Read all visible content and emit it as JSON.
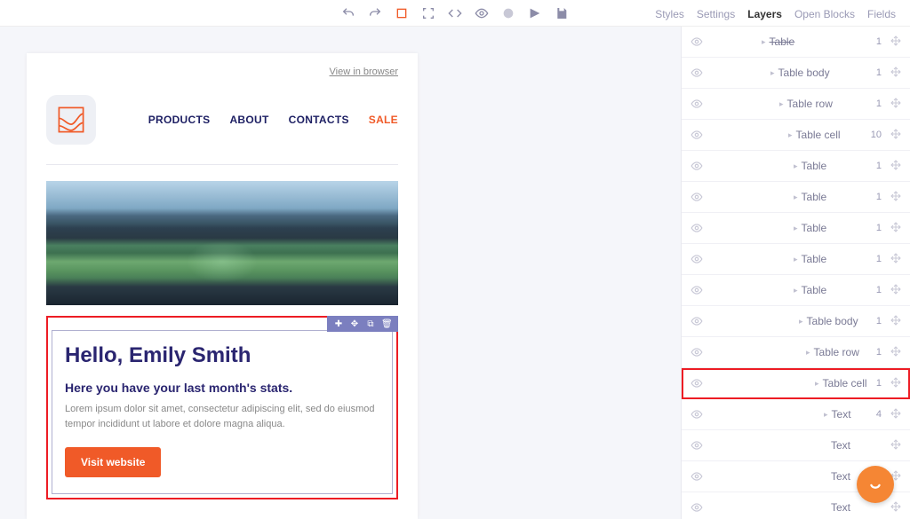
{
  "toolbar": {
    "icons": [
      "undo",
      "redo",
      "stop",
      "fullscreen",
      "code",
      "eye",
      "component",
      "play",
      "save"
    ]
  },
  "panelTabs": [
    "Styles",
    "Settings",
    "Layers",
    "Open Blocks",
    "Fields"
  ],
  "activeTab": "Layers",
  "email": {
    "viewBrowser": "View in browser",
    "nav": {
      "products": "PRODUCTS",
      "about": "ABOUT",
      "contacts": "CONTACTS",
      "sale": "SALE"
    },
    "card": {
      "title": "Hello, Emily Smith",
      "subtitle": "Here you have your last month's stats.",
      "body": "Lorem ipsum dolor sit amet, consectetur adipiscing elit, sed do eiusmod tempor incididunt ut labore et dolore magna aliqua.",
      "cta": "Visit website"
    }
  },
  "layers": [
    {
      "label": "Table",
      "indent": 90,
      "count": "1",
      "chev": true,
      "strike": true
    },
    {
      "label": "Table body",
      "indent": 100,
      "count": "1",
      "chev": true
    },
    {
      "label": "Table row",
      "indent": 110,
      "count": "1",
      "chev": true
    },
    {
      "label": "Table cell",
      "indent": 120,
      "count": "10",
      "chev": true
    },
    {
      "label": "Table",
      "indent": 126,
      "count": "1",
      "chev": true
    },
    {
      "label": "Table",
      "indent": 126,
      "count": "1",
      "chev": true
    },
    {
      "label": "Table",
      "indent": 126,
      "count": "1",
      "chev": true
    },
    {
      "label": "Table",
      "indent": 126,
      "count": "1",
      "chev": true
    },
    {
      "label": "Table",
      "indent": 126,
      "count": "1",
      "chev": true
    },
    {
      "label": "Table body",
      "indent": 132,
      "count": "1",
      "chev": true
    },
    {
      "label": "Table row",
      "indent": 140,
      "count": "1",
      "chev": true
    },
    {
      "label": "Table cell",
      "indent": 150,
      "count": "1",
      "chev": true,
      "selected": true
    },
    {
      "label": "Text",
      "indent": 160,
      "count": "4",
      "chev": true
    },
    {
      "label": "Text",
      "indent": 168,
      "count": "",
      "chev": false
    },
    {
      "label": "Text",
      "indent": 168,
      "count": "",
      "chev": false
    },
    {
      "label": "Text",
      "indent": 168,
      "count": "",
      "chev": false
    }
  ]
}
